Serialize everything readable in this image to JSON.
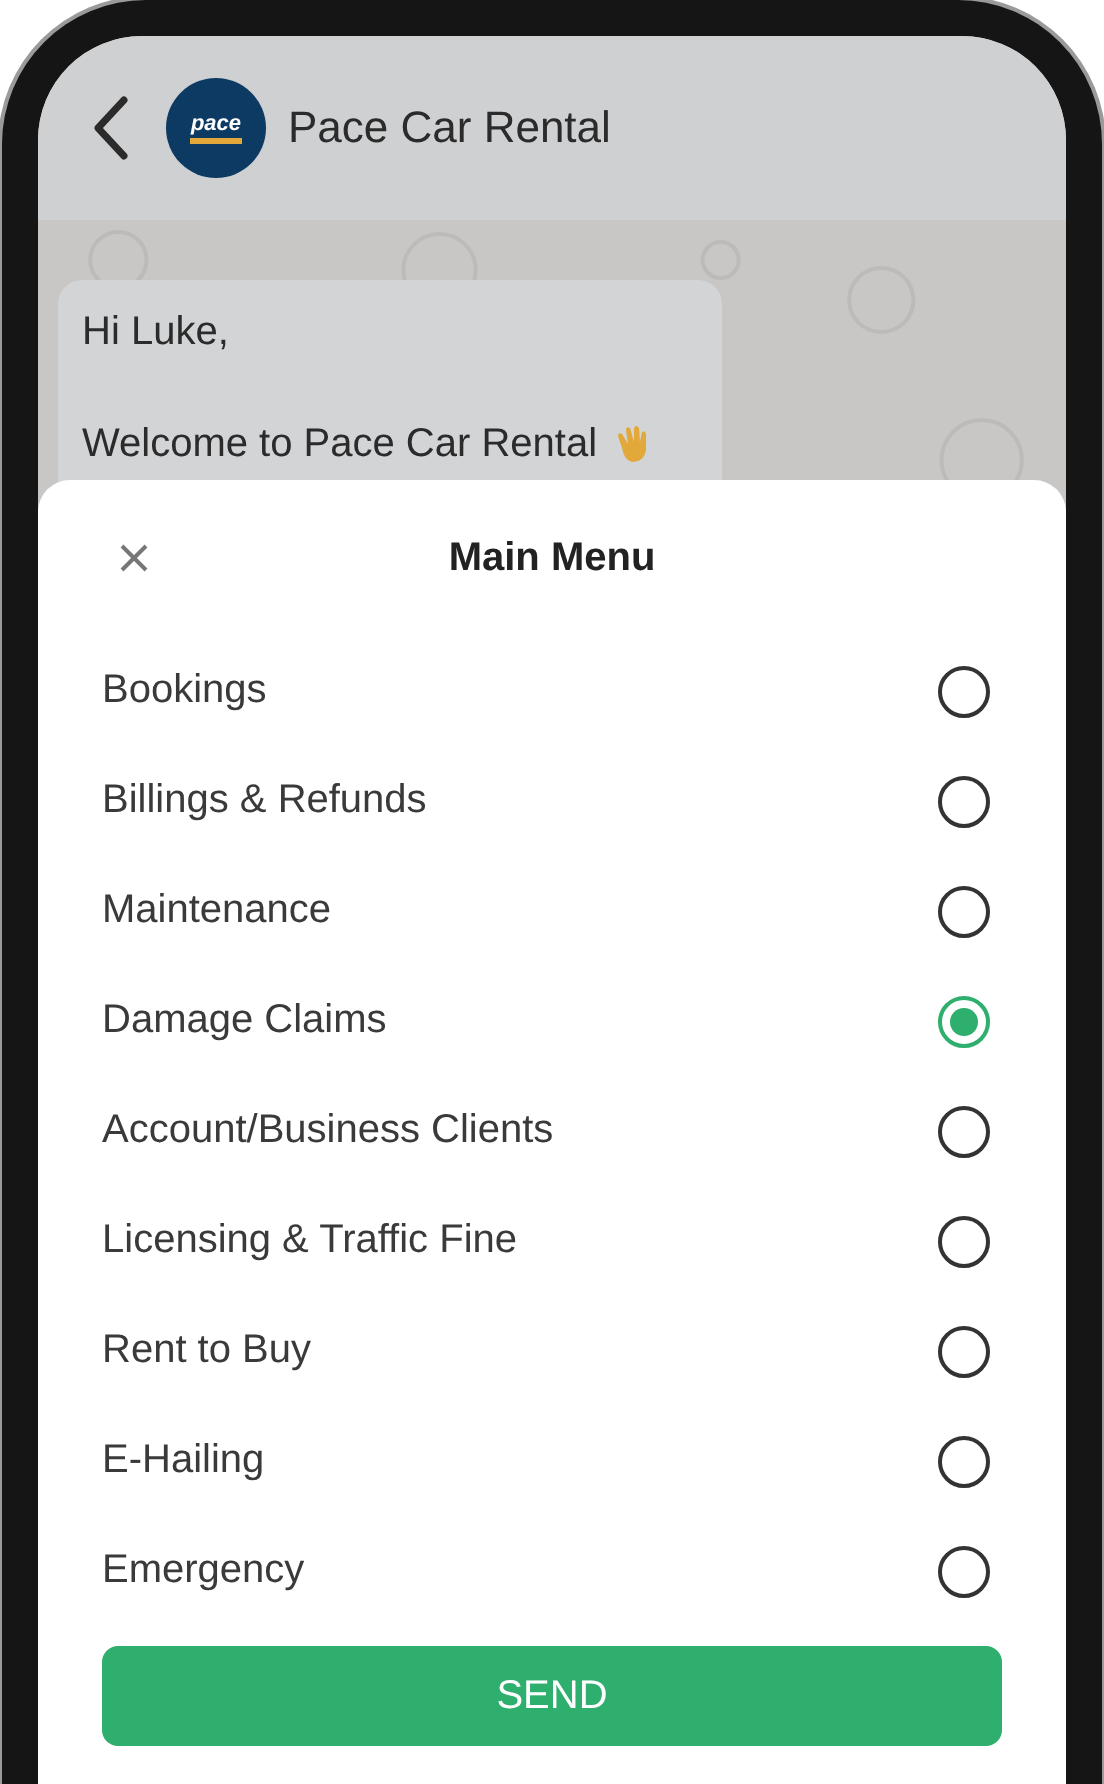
{
  "header": {
    "title": "Pace Car Rental",
    "logo_text": "pace"
  },
  "message": {
    "lines": [
      "Hi Luke,",
      "Welcome to Pace Car Rental"
    ]
  },
  "sheet": {
    "title": "Main Menu",
    "options": [
      {
        "label": "Bookings",
        "selected": false
      },
      {
        "label": "Billings & Refunds",
        "selected": false
      },
      {
        "label": "Maintenance",
        "selected": false
      },
      {
        "label": "Damage Claims",
        "selected": true
      },
      {
        "label": "Account/Business Clients",
        "selected": false
      },
      {
        "label": "Licensing & Traffic Fine",
        "selected": false
      },
      {
        "label": "Rent to Buy",
        "selected": false
      },
      {
        "label": "E-Hailing",
        "selected": false
      },
      {
        "label": "Emergency",
        "selected": false
      }
    ],
    "button": "SEND"
  }
}
